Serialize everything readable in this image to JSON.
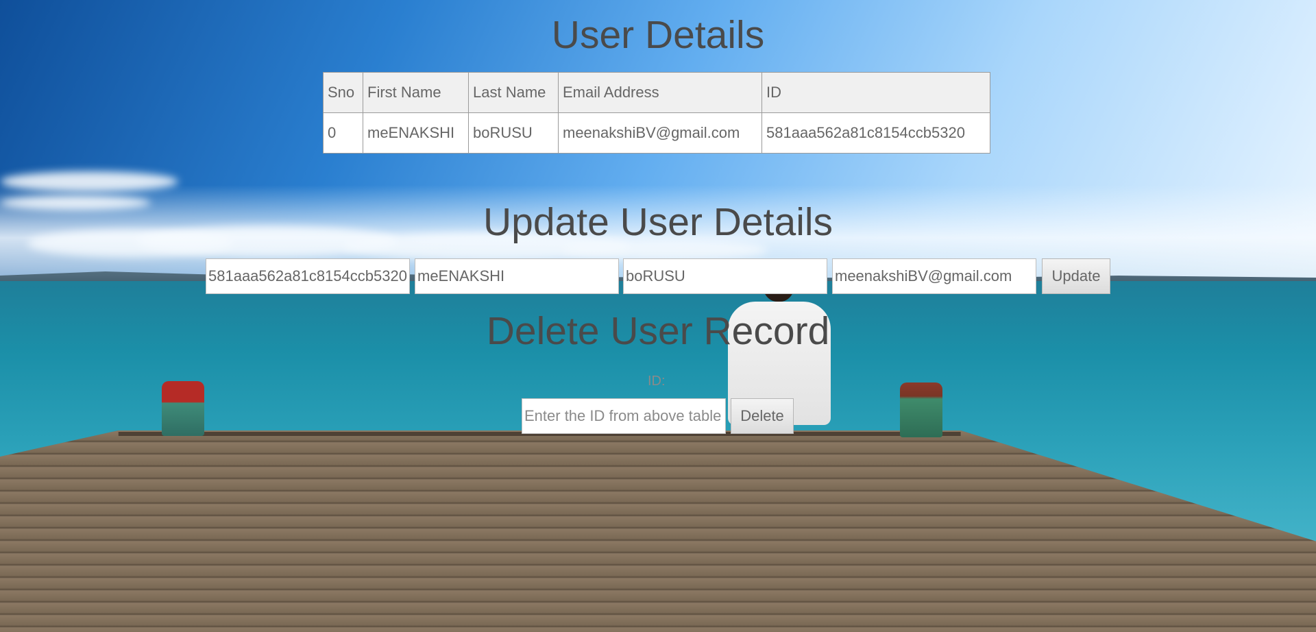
{
  "user_details": {
    "title": "User Details",
    "columns": [
      "Sno",
      "First Name",
      "Last Name",
      "Email Address",
      "ID"
    ],
    "rows": [
      [
        "0",
        "meENAKSHI",
        "boRUSU",
        "meenakshiBV@gmail.com",
        "581aaa562a81c8154ccb5320"
      ]
    ]
  },
  "update_user": {
    "title": "Update User Details",
    "id_value": "581aaa562a81c8154ccb5320",
    "first_name_value": "meENAKSHI",
    "last_name_value": "boRUSU",
    "email_value": "meenakshiBV@gmail.com",
    "button_label": "Update"
  },
  "delete_user": {
    "title": "Delete User Record",
    "id_label": "ID:",
    "id_placeholder": "Enter the ID from above table",
    "button_label": "Delete"
  }
}
